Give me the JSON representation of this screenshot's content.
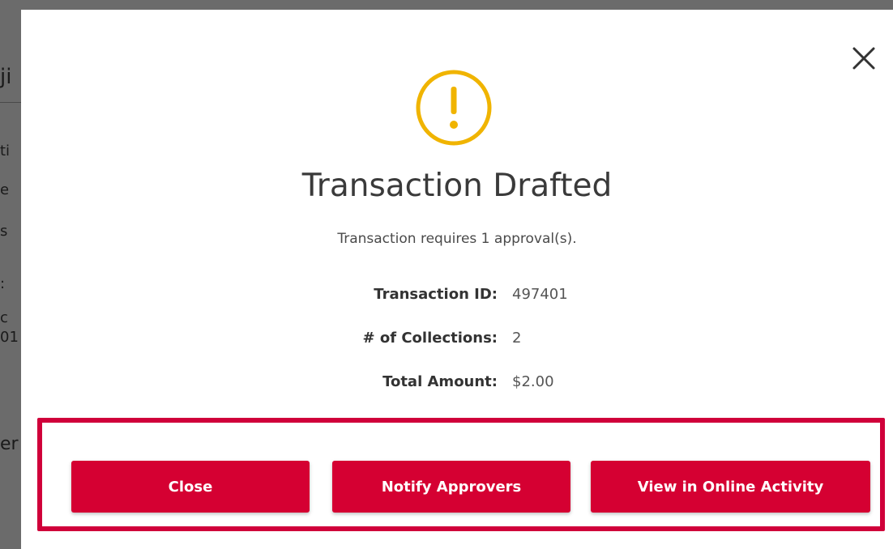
{
  "background": {
    "fragments": [
      "ji",
      "ti",
      "e",
      "s",
      ":",
      "c",
      "01",
      "er"
    ]
  },
  "modal": {
    "title": "Transaction Drafted",
    "subtitle": "Transaction requires 1 approval(s).",
    "close_icon": "close-x-icon",
    "status_icon": "warning-exclamation-icon",
    "details": [
      {
        "label": "Transaction ID:",
        "value": "497401"
      },
      {
        "label": "# of Collections:",
        "value": "2"
      },
      {
        "label": "Total Amount:",
        "value": "$2.00"
      }
    ],
    "buttons": {
      "close": "Close",
      "notify": "Notify Approvers",
      "view": "View in Online Activity"
    }
  },
  "colors": {
    "accent": "#d50032",
    "highlight_border": "#d0003a",
    "warning": "#f0b400"
  }
}
